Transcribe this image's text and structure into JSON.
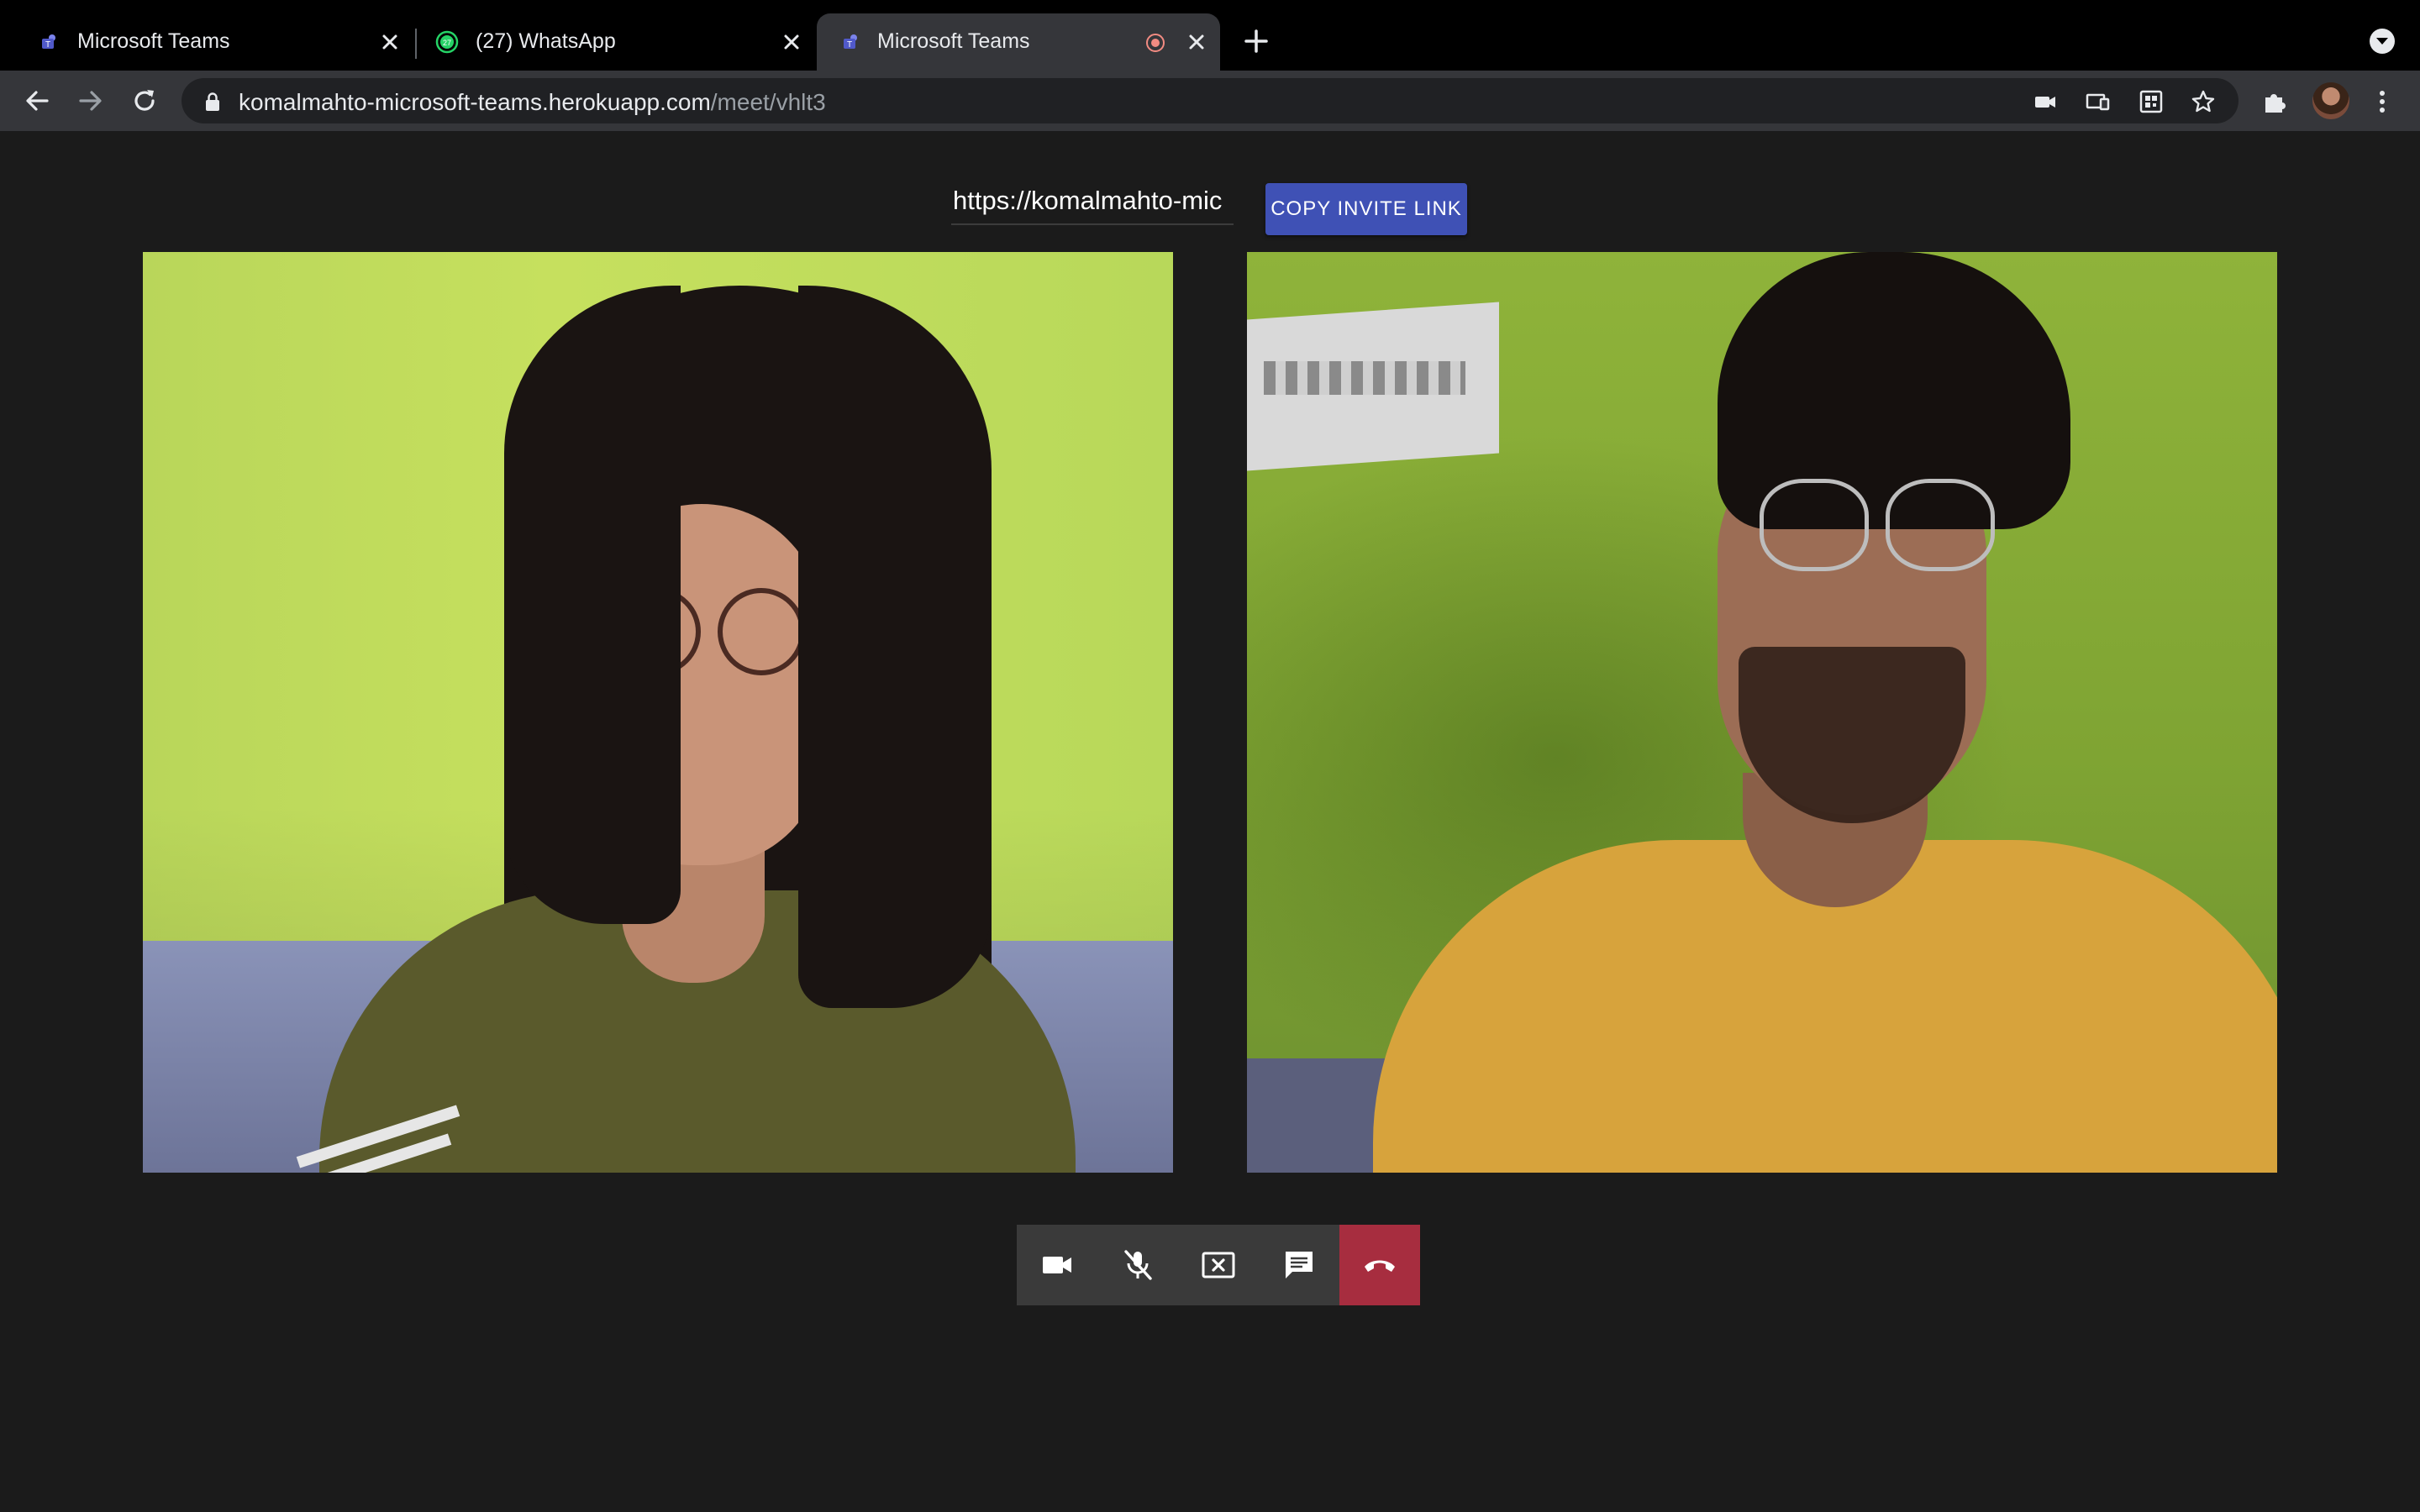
{
  "browser": {
    "tabs": [
      {
        "title": "Microsoft Teams",
        "favicon": "teams-icon",
        "active": false
      },
      {
        "title": "(27) WhatsApp",
        "favicon": "whatsapp-icon",
        "badge": "27",
        "active": false
      },
      {
        "title": "Microsoft Teams",
        "favicon": "teams-icon",
        "active": true,
        "recording": true
      }
    ],
    "address": {
      "host": "komalmahto-microsoft-teams.herokuapp.com",
      "path": "/meet/vhlt3"
    }
  },
  "meeting": {
    "invite_link_value": "https://komalmahto-mic",
    "copy_button_label": "COPY INVITE LINK",
    "copy_button_color": "#3f51b5",
    "controls": [
      {
        "name": "video-camera-icon"
      },
      {
        "name": "mic-off-icon"
      },
      {
        "name": "stop-screen-share-icon"
      },
      {
        "name": "chat-icon"
      },
      {
        "name": "hang-up-icon",
        "color": "#a72d3f"
      }
    ]
  },
  "colors": {
    "page_background": "#1b1b1b",
    "tab_active": "#35363a",
    "tab_strip": "#000000"
  }
}
